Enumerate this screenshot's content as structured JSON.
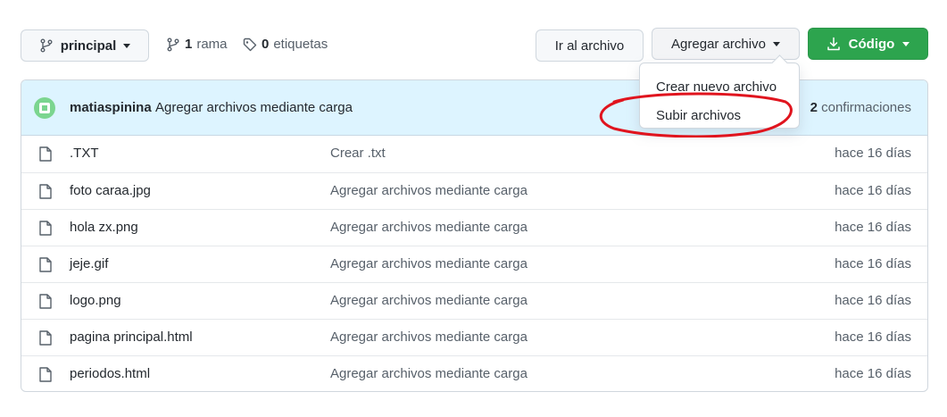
{
  "toolbar": {
    "branch_label": "principal",
    "branch_count": "1",
    "branch_word": "rama",
    "tag_count": "0",
    "tag_word": "etiquetas",
    "goto_file": "Ir al archivo",
    "add_file": "Agregar archivo",
    "code": "Código",
    "code_color": "#2da44e"
  },
  "dropdown": {
    "items": [
      "Crear nuevo archivo",
      "Subir archivos"
    ]
  },
  "commit": {
    "user": "matiaspinina",
    "message": "Agregar archivos mediante carga",
    "count": "2",
    "count_word": "confirmaciones"
  },
  "files": [
    {
      "name": ".TXT",
      "commit": "Crear .txt",
      "age": "hace 16 días"
    },
    {
      "name": "foto caraa.jpg",
      "commit": "Agregar archivos mediante carga",
      "age": "hace 16 días"
    },
    {
      "name": "hola zx.png",
      "commit": "Agregar archivos mediante carga",
      "age": "hace 16 días"
    },
    {
      "name": "jeje.gif",
      "commit": "Agregar archivos mediante carga",
      "age": "hace 16 días"
    },
    {
      "name": "logo.png",
      "commit": "Agregar archivos mediante carga",
      "age": "hace 16 días"
    },
    {
      "name": "pagina principal.html",
      "commit": "Agregar archivos mediante carga",
      "age": "hace 16 días"
    },
    {
      "name": "periodos.html",
      "commit": "Agregar archivos mediante carga",
      "age": "hace 16 días"
    }
  ],
  "annotation": {
    "color": "#e0141e",
    "icon": "red-ellipse-highlight"
  }
}
